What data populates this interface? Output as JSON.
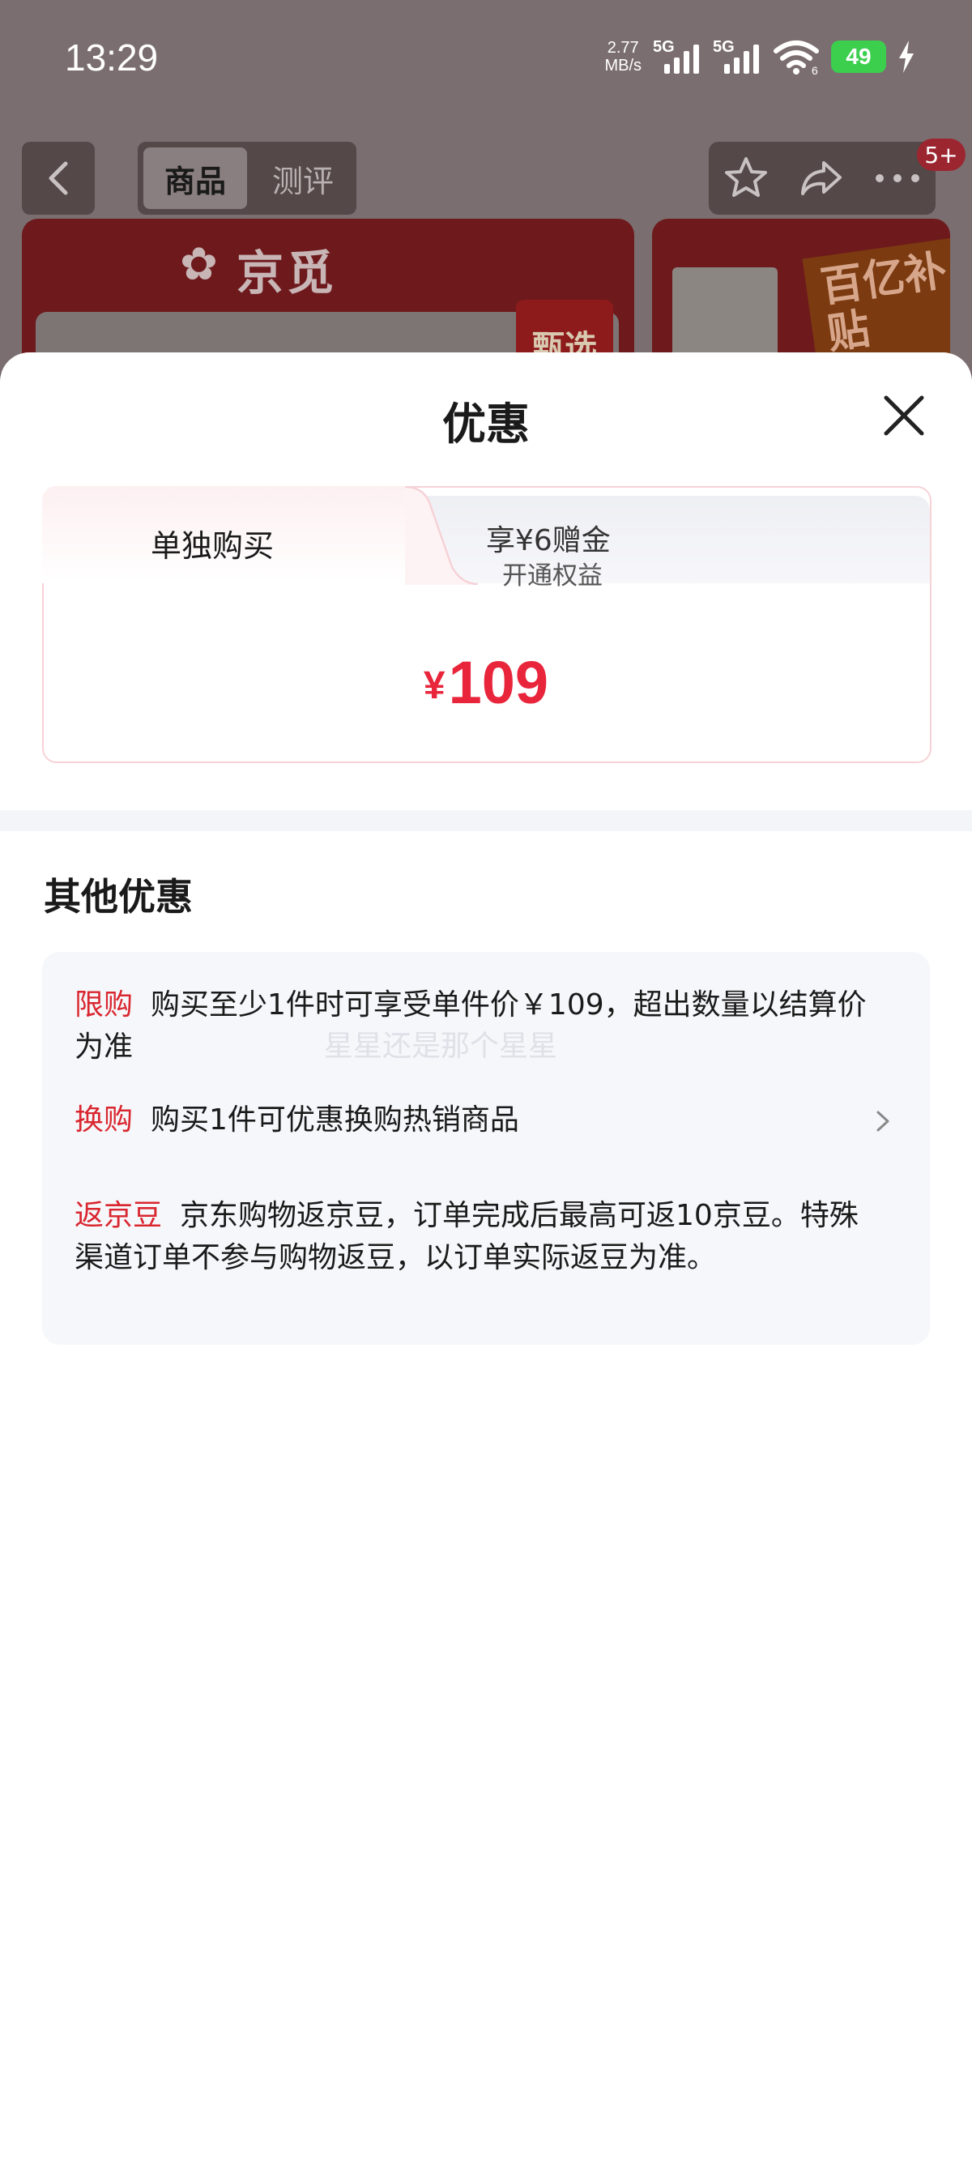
{
  "status_bar": {
    "time": "13:29",
    "net_speed_value": "2.77",
    "net_speed_unit": "MB/s",
    "sim1_label": "5G",
    "sim2_label": "5G",
    "wifi_sub": "6",
    "battery": "49"
  },
  "nav": {
    "tabs": [
      "商品",
      "测评"
    ],
    "badge": "5+"
  },
  "banner": {
    "brand": "京觅",
    "pick_label": "甄选",
    "subsidy_label": "百亿补贴"
  },
  "sheet": {
    "title": "优惠",
    "price_card": {
      "tab_single": "单独购买",
      "tab_member_title": "享¥6赠金",
      "tab_member_sub": "开通权益",
      "currency": "¥",
      "price": "109"
    },
    "other_title": "其他优惠",
    "promos": [
      {
        "tag": "限购",
        "text": "购买至少1件时可享受单件价￥109，超出数量以结算价为准",
        "has_arrow": false
      },
      {
        "tag": "换购",
        "text": "购买1件可优惠换购热销商品",
        "has_arrow": true
      },
      {
        "tag": "返京豆",
        "text": "京东购物返京豆，订单完成后最高可返10京豆。特殊渠道订单不参与购物返豆，以订单实际返豆为准。",
        "has_arrow": false
      }
    ],
    "watermark": "星星还是那个星星"
  },
  "colors": {
    "accent_red": "#e8253b",
    "tag_red": "#d9262f",
    "battery_green": "#3ccf4e"
  },
  "icons": [
    "back-arrow-icon",
    "star-icon",
    "share-icon",
    "more-icon",
    "close-icon",
    "chevron-right-icon",
    "wifi-icon",
    "signal-icon",
    "battery-icon",
    "charging-bolt-icon"
  ]
}
